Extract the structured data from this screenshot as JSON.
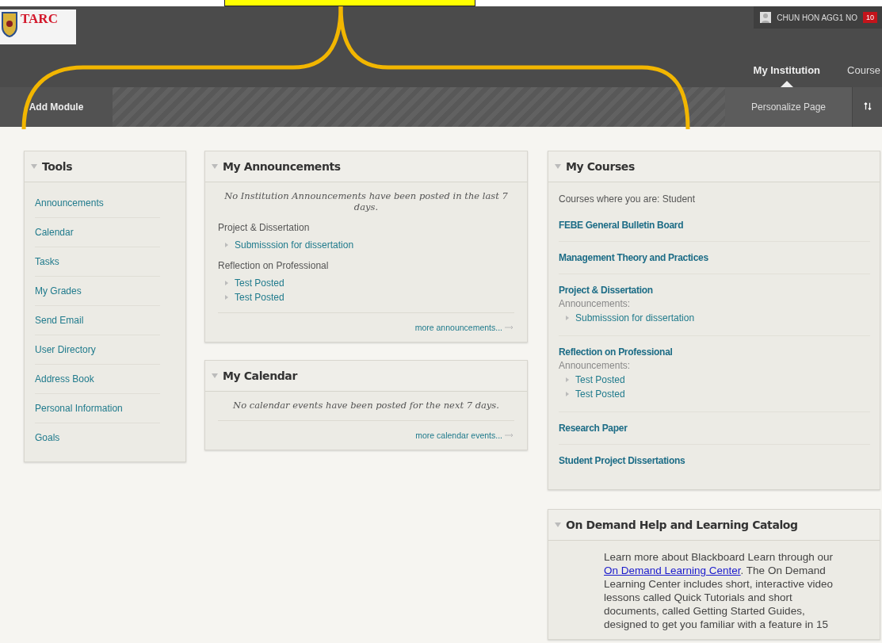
{
  "header": {
    "logo_text": "TARC",
    "user_name": "CHUN HON AGG1 NO",
    "notification_count": "10"
  },
  "nav_tabs": [
    {
      "label": "My Institution",
      "selected": true
    },
    {
      "label": "Course",
      "selected": false
    }
  ],
  "toolbar": {
    "add_module": "Add Module",
    "personalize": "Personalize Page"
  },
  "tools": {
    "title": "Tools",
    "items": [
      "Announcements",
      "Calendar",
      "Tasks",
      "My Grades",
      "Send Email",
      "User Directory",
      "Address Book",
      "Personal Information",
      "Goals"
    ]
  },
  "announcements": {
    "title": "My Announcements",
    "message": "No Institution Announcements have been posted in the last 7 days.",
    "groups": [
      {
        "course": "Project & Dissertation",
        "items": [
          "Submisssion for dissertation"
        ]
      },
      {
        "course": "Reflection on Professional",
        "items": [
          "Test Posted",
          "Test Posted"
        ]
      }
    ],
    "more_link": "more announcements..."
  },
  "calendar": {
    "title": "My Calendar",
    "message": "No calendar events have been posted for the next 7 days.",
    "more_link": "more calendar events..."
  },
  "courses": {
    "title": "My Courses",
    "intro": "Courses where you are: Student",
    "list": [
      {
        "title": "FEBE General Bulletin Board"
      },
      {
        "title": "Management Theory and Practices"
      },
      {
        "title": "Project & Dissertation",
        "announcements_label": "Announcements:",
        "items": [
          "Submisssion for dissertation"
        ]
      },
      {
        "title": "Reflection on Professional",
        "announcements_label": "Announcements:",
        "items": [
          "Test Posted",
          "Test Posted"
        ]
      },
      {
        "title": "Research Paper"
      },
      {
        "title": "Student Project Dissertations"
      }
    ]
  },
  "help": {
    "title": "On Demand Help and Learning Catalog",
    "text_before": "Learn more about Blackboard Learn through our",
    "link": "On Demand Learning Center",
    "text_after": ". The On Demand Learning Center includes short, interactive video lessons called Quick Tutorials and short documents, called Getting Started Guides, designed to get you familiar with a feature in 15"
  }
}
